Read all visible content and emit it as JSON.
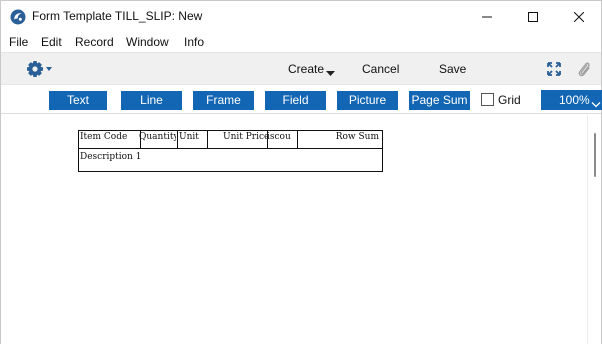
{
  "window": {
    "title": "Form Template TILL_SLIP: New"
  },
  "menu": {
    "items": [
      "File",
      "Edit",
      "Record",
      "Window",
      "Info"
    ]
  },
  "toolbar": {
    "create_label": "Create",
    "cancel_label": "Cancel",
    "save_label": "Save"
  },
  "palette": {
    "buttons": [
      "Text",
      "Line",
      "Frame",
      "Field",
      "Picture",
      "Page Sum"
    ],
    "grid_label": "Grid",
    "grid_checked": false,
    "zoom": "100%"
  },
  "form": {
    "header_fields": [
      "Item Code",
      "Quantity",
      "Unit",
      "Unit Price",
      "iscou",
      "Row Sum"
    ],
    "body_fields": [
      "Description 1"
    ]
  },
  "colors": {
    "accent": "#1266b3",
    "toolbar_bg": "#f0f0f0"
  },
  "icons": {
    "app": "app-logo-icon",
    "minimize": "minimize-icon",
    "maximize": "maximize-icon",
    "close": "close-icon",
    "settings": "gear-icon",
    "fullscreen": "expand-icon",
    "attach": "paperclip-icon"
  }
}
